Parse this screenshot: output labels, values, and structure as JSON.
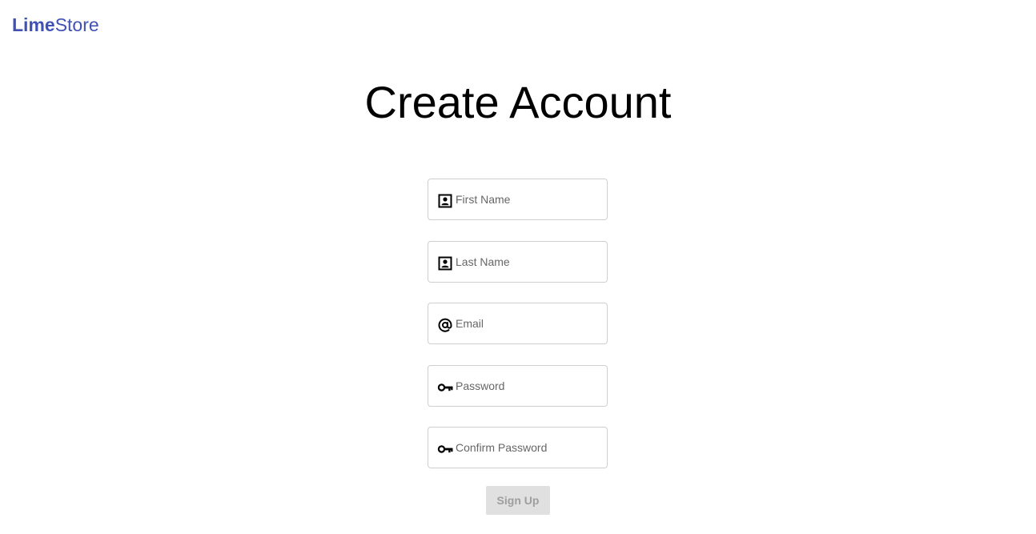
{
  "brand": {
    "name_bold": "Lime",
    "name_regular": "Store",
    "color": "#3f51b5"
  },
  "page_title": "Create Account",
  "form": {
    "fields": [
      {
        "icon": "contact-card-icon",
        "placeholder": "First Name",
        "value": ""
      },
      {
        "icon": "contact-card-icon",
        "placeholder": "Last Name",
        "value": ""
      },
      {
        "icon": "at-sign-icon",
        "placeholder": "Email",
        "value": ""
      },
      {
        "icon": "key-icon",
        "placeholder": "Password",
        "value": ""
      },
      {
        "icon": "key-icon",
        "placeholder": "Confirm Password",
        "value": ""
      }
    ],
    "submit_label": "Sign Up",
    "submit_state": "disabled"
  }
}
